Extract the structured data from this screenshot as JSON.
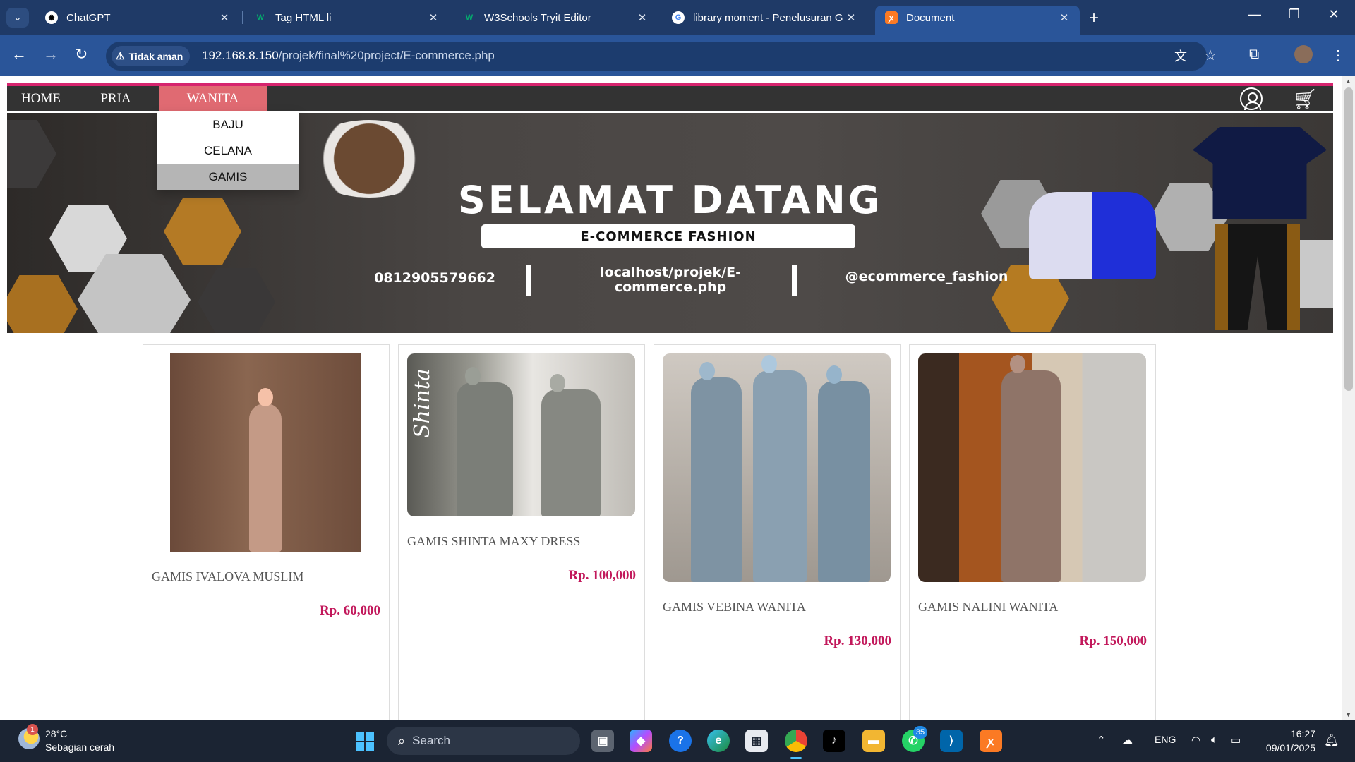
{
  "browser": {
    "tabs": [
      {
        "title": "ChatGPT",
        "icon": "chatgpt-icon",
        "active": false
      },
      {
        "title": "Tag HTML li",
        "icon": "w3schools-icon",
        "active": false
      },
      {
        "title": "W3Schools Tryit Editor",
        "icon": "w3schools-icon",
        "active": false
      },
      {
        "title": "library moment - Penelusuran G",
        "icon": "google-icon",
        "active": false
      },
      {
        "title": "Document",
        "icon": "xampp-icon",
        "active": true
      }
    ],
    "security_label": "Tidak aman",
    "url_host": "192.168.8.150",
    "url_path": "/projek/final%20project/E-commerce.php"
  },
  "nav": {
    "items": [
      "HOME",
      "PRIA",
      "WANITA"
    ],
    "active_item": "WANITA",
    "dropdown": [
      "BAJU",
      "CELANA",
      "GAMIS"
    ],
    "hovered_dropdown_item": "GAMIS"
  },
  "banner": {
    "title": "SELAMAT DATANG",
    "subtitle": "E-COMMERCE FASHION",
    "phone": "0812905579662",
    "website_line1": "localhost/projek/E-",
    "website_line2": "commerce.php",
    "social": "@ecommerce_fashion"
  },
  "products": [
    {
      "name": "GAMIS IVALOVA MUSLIM",
      "price": "Rp. 60,000"
    },
    {
      "name": "GAMIS SHINTA MAXY DRESS",
      "price": "Rp. 100,000",
      "image_caption": "Shinta"
    },
    {
      "name": "GAMIS VEBINA WANITA",
      "price": "Rp. 130,000"
    },
    {
      "name": "GAMIS NALINI WANITA",
      "price": "Rp. 150,000"
    }
  ],
  "taskbar": {
    "weather_temp": "28°C",
    "weather_desc": "Sebagian cerah",
    "weather_badge": "1",
    "search_placeholder": "Search",
    "whatsapp_badge": "35",
    "language": "ENG",
    "time": "16:27",
    "date": "09/01/2025"
  },
  "colors": {
    "tab_strip": "#1f3a67",
    "toolbar": "#2a5599",
    "nav_bar": "#333333",
    "nav_accent": "#d6246e",
    "nav_active": "#e06a72",
    "price": "#c2185b"
  }
}
